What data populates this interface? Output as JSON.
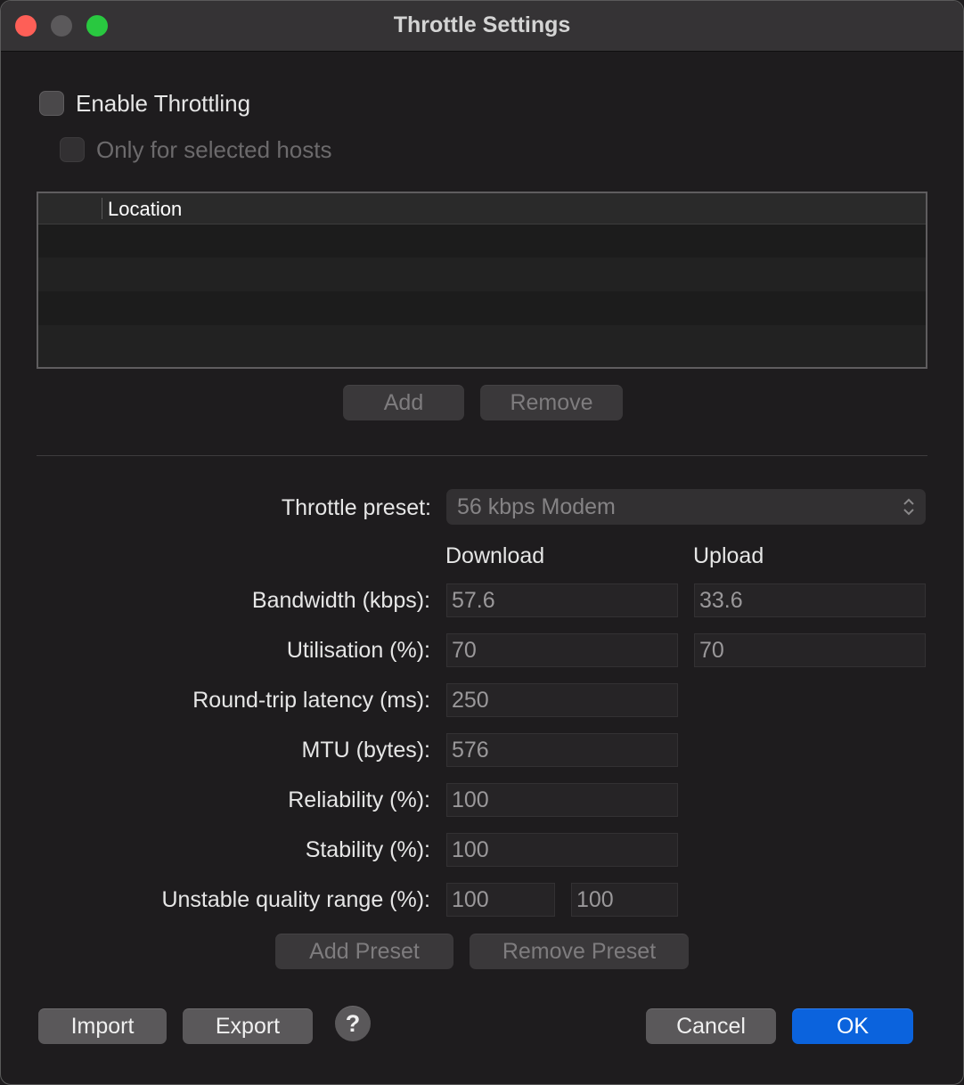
{
  "window": {
    "title": "Throttle Settings"
  },
  "throttling": {
    "enable_label": "Enable Throttling",
    "enable_checked": false,
    "selected_hosts_label": "Only for selected hosts",
    "selected_hosts_checked": false
  },
  "hosts_table": {
    "column_header": "Location",
    "rows": []
  },
  "hosts_buttons": {
    "add": "Add",
    "remove": "Remove"
  },
  "preset": {
    "label": "Throttle preset:",
    "selected": "56 kbps Modem"
  },
  "columns": {
    "download": "Download",
    "upload": "Upload"
  },
  "fields": {
    "bandwidth": {
      "label": "Bandwidth (kbps):",
      "download": "57.6",
      "upload": "33.6"
    },
    "utilisation": {
      "label": "Utilisation (%):",
      "download": "70",
      "upload": "70"
    },
    "latency": {
      "label": "Round-trip latency (ms):",
      "value": "250"
    },
    "mtu": {
      "label": "MTU (bytes):",
      "value": "576"
    },
    "reliability": {
      "label": "Reliability (%):",
      "value": "100"
    },
    "stability": {
      "label": "Stability (%):",
      "value": "100"
    },
    "unstable_quality": {
      "label": "Unstable quality range (%):",
      "min": "100",
      "max": "100"
    }
  },
  "preset_buttons": {
    "add": "Add Preset",
    "remove": "Remove Preset"
  },
  "footer": {
    "import": "Import",
    "export": "Export",
    "help": "?",
    "cancel": "Cancel",
    "ok": "OK"
  },
  "colors": {
    "accent": "#0b63dd",
    "close": "#fe5f57",
    "zoom": "#29c840"
  }
}
